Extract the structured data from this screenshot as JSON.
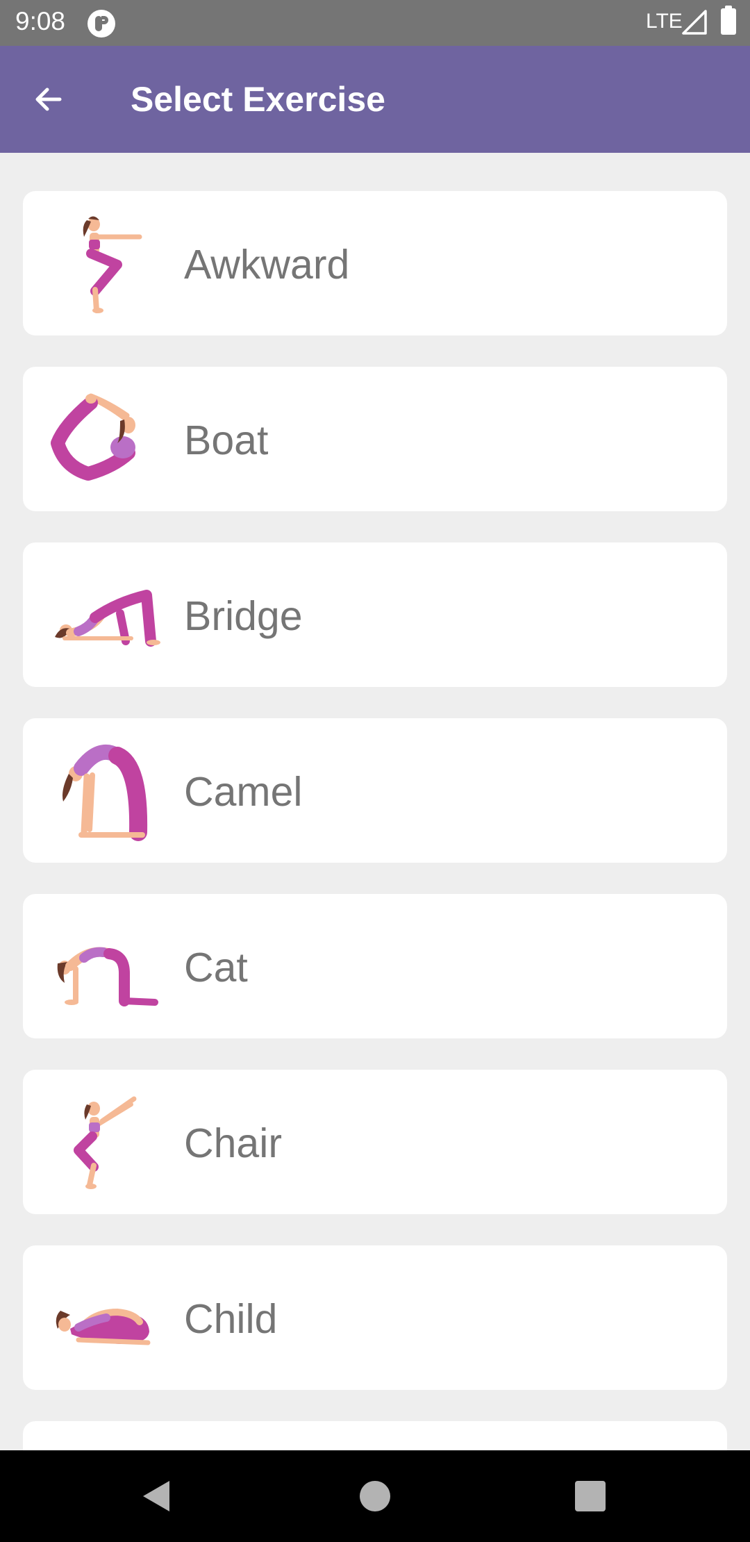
{
  "status_bar": {
    "time": "9:08",
    "network": "LTE"
  },
  "app_bar": {
    "title": "Select Exercise",
    "back_icon": "arrow-left-icon"
  },
  "exercises": [
    {
      "label": "Awkward",
      "icon": "awkward-pose-icon"
    },
    {
      "label": "Boat",
      "icon": "boat-pose-icon"
    },
    {
      "label": "Bridge",
      "icon": "bridge-pose-icon"
    },
    {
      "label": "Camel",
      "icon": "camel-pose-icon"
    },
    {
      "label": "Cat",
      "icon": "cat-pose-icon"
    },
    {
      "label": "Chair",
      "icon": "chair-pose-icon"
    },
    {
      "label": "Child",
      "icon": "child-pose-icon"
    }
  ],
  "colors": {
    "app_bar": "#6f64a0",
    "background": "#eeeeee",
    "card": "#ffffff",
    "label_text": "#757575",
    "pose_outfit": "#c043a0",
    "pose_skin": "#f5b995",
    "pose_hair": "#6b3a2a"
  },
  "nav_bar": {
    "back": "nav-back-icon",
    "home": "nav-home-icon",
    "recents": "nav-recents-icon"
  }
}
